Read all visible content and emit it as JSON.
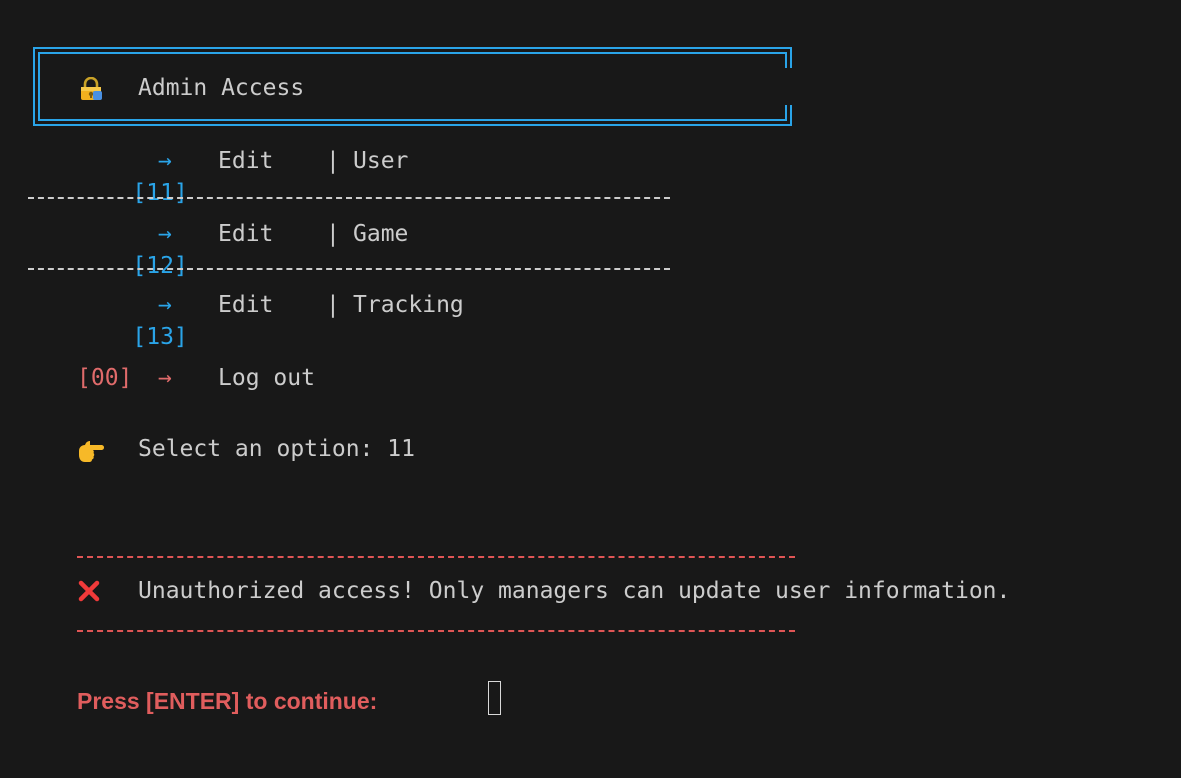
{
  "header": {
    "icon": "lock-icon",
    "title": "Admin Access"
  },
  "menu": [
    {
      "key": "[11]",
      "arrow": "→",
      "action": "Edit",
      "sep": "|",
      "target": "User"
    },
    {
      "key": "[12]",
      "arrow": "→",
      "action": "Edit",
      "sep": "|",
      "target": "Game"
    },
    {
      "key": "[13]",
      "arrow": "→",
      "action": "Edit",
      "sep": "|",
      "target": "Tracking"
    }
  ],
  "logout": {
    "key": "[00]",
    "arrow": "→",
    "label": "Log out"
  },
  "prompt": {
    "icon": "pointing-hand-icon",
    "text": "Select an option: 11"
  },
  "error": {
    "icon": "cross-mark-icon",
    "message": "Unauthorized access! Only managers can update user information."
  },
  "continue_prompt": "Press [ENTER] to continue:",
  "colors": {
    "background": "#181818",
    "text": "#cccccc",
    "accent_blue": "#2aa4e8",
    "accent_red": "#e05d5d"
  }
}
